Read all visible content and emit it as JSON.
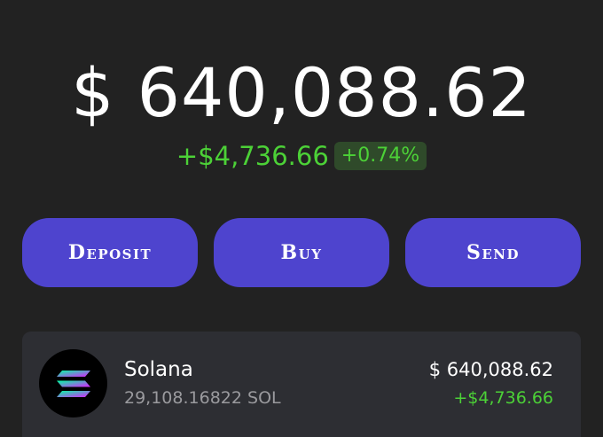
{
  "portfolio": {
    "balance": "$ 640,088.62",
    "change_amount": "+$4,736.66",
    "change_percent": "+0.74%"
  },
  "actions": {
    "deposit_label": "Deposit",
    "buy_label": "Buy",
    "send_label": "Send"
  },
  "tokens": [
    {
      "name": "Solana",
      "quantity": "29,108.16822 SOL",
      "value": "$ 640,088.62",
      "change": "+$4,736.66",
      "icon": "solana-logo-icon"
    }
  ],
  "colors": {
    "background": "#222222",
    "accent": "#4e44ce",
    "positive": "#4cd137",
    "positive_badge_bg": "#2f4a2a",
    "card": "#2d2e33"
  }
}
